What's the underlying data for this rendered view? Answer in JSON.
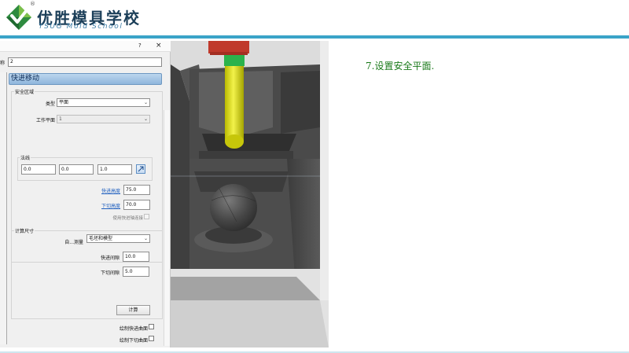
{
  "brand": {
    "name_cn": "优胜模具学校",
    "name_en": "YSUG Mold School",
    "registered_mark": "®"
  },
  "dialog": {
    "help_glyph": "?",
    "close_glyph": "×",
    "name_label": "称",
    "name_value": "2",
    "page_tab_label": "快进移动",
    "safe_area": {
      "title": "安全区域",
      "type_label": "类型",
      "type_value": "平面",
      "workplane_label": "工作平面",
      "workplane_value": "1",
      "normal_title": "法线",
      "normal_x": "0.0",
      "normal_y": "0.0",
      "normal_z": "1.0",
      "rapid_height_label": "快进高度",
      "rapid_height_value": "75.0",
      "plunge_height_label": "下切高度",
      "plunge_height_value": "70.0",
      "axial_link_label": "使用快进轴连接"
    },
    "calc_size": {
      "title": "计算尺寸",
      "measure_label": "自...测量",
      "measure_value": "毛坯和模型",
      "rapid_gap_label": "快进间隙",
      "rapid_gap_value": "10.0",
      "plunge_gap_label": "下切间隙",
      "plunge_gap_value": "5.0",
      "calculate_button": "计算"
    },
    "draw_rapid_surface_label": "绘制快进曲面",
    "draw_plunge_surface_label": "绘制下切曲面"
  },
  "instruction": {
    "text": "7.设置安全平面."
  },
  "colors": {
    "accent_rule": "#3aa3c8",
    "instruction_text": "#1a7a1a",
    "tool_shank": "#d8d80a",
    "tool_holder_top": "#c0392b",
    "tool_collar": "#2bb24c",
    "part_dark": "#505050"
  }
}
